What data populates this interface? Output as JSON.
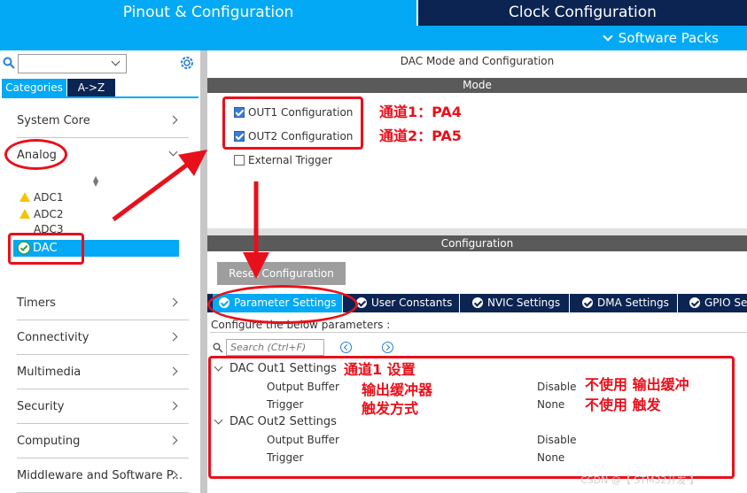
{
  "header": {
    "tab_pinout": "Pinout & Configuration",
    "tab_clock": "Clock Configuration",
    "software_packs": "Software Packs"
  },
  "sidebar": {
    "search_value": "",
    "tab_categories": "Categories",
    "tab_az": "A->Z",
    "categories": [
      {
        "label": "System Core"
      },
      {
        "label": "Analog"
      },
      {
        "label": "Timers"
      },
      {
        "label": "Connectivity"
      },
      {
        "label": "Multimedia"
      },
      {
        "label": "Security"
      },
      {
        "label": "Computing"
      },
      {
        "label": "Middleware and Software P..."
      }
    ],
    "analog_items": [
      {
        "label": "ADC1",
        "status": "warning"
      },
      {
        "label": "ADC2",
        "status": "warning"
      },
      {
        "label": "ADC3",
        "status": "none"
      },
      {
        "label": "DAC",
        "status": "ok"
      }
    ]
  },
  "main": {
    "title": "DAC Mode and Configuration",
    "mode_header": "Mode",
    "mode_options": [
      {
        "label": "OUT1 Configuration",
        "checked": true
      },
      {
        "label": "OUT2 Configuration",
        "checked": true
      },
      {
        "label": "External Trigger",
        "checked": false
      }
    ],
    "config_header": "Configuration",
    "reset_button": "Reset Configuration",
    "tabs": [
      {
        "label": "Parameter Settings",
        "active": true
      },
      {
        "label": "User Constants",
        "active": false
      },
      {
        "label": "NVIC Settings",
        "active": false
      },
      {
        "label": "DMA Settings",
        "active": false
      },
      {
        "label": "GPIO Se",
        "active": false
      }
    ],
    "hint": "Configure the below parameters :",
    "search_placeholder": "Search (Ctrl+F)",
    "groups": [
      {
        "title": "DAC Out1 Settings",
        "params": [
          {
            "name": "Output Buffer",
            "value": "Disable"
          },
          {
            "name": "Trigger",
            "value": "None"
          }
        ]
      },
      {
        "title": "DAC Out2 Settings",
        "params": [
          {
            "name": "Output Buffer",
            "value": "Disable"
          },
          {
            "name": "Trigger",
            "value": "None"
          }
        ]
      }
    ]
  },
  "annotations": {
    "ch1": "通道1：PA4",
    "ch2": "通道2：PA5",
    "ch1_settings": "通道1 设置",
    "output_buffer": "输出缓冲器",
    "trigger_mode": "触发方式",
    "no_buffer": "不使用 输出缓冲",
    "no_trigger": "不使用 触发",
    "color": "#E8101B"
  },
  "watermark": "CSDN @【 STM32开发 】"
}
